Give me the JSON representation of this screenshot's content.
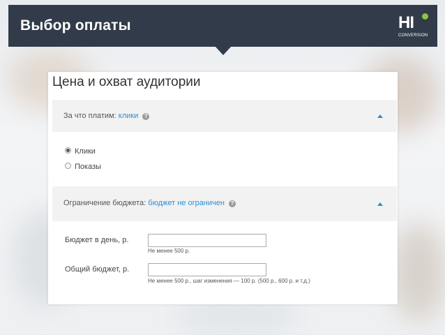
{
  "header": {
    "title": "Выбор оплаты",
    "logo_main": "HI",
    "logo_sub": "CONVERSION"
  },
  "panel": {
    "title": "Цена и охват аудитории",
    "payment_section": {
      "label": "За что платим:",
      "value": "клики",
      "help_icon": "question-icon",
      "options": [
        {
          "label": "Клики",
          "checked": true
        },
        {
          "label": "Показы",
          "checked": false
        }
      ]
    },
    "budget_section": {
      "label": "Ограничение бюджета:",
      "value": "бюджет не ограничен",
      "help_icon": "question-icon",
      "fields": [
        {
          "label": "Бюджет в день, р.",
          "value": "",
          "hint": "Не менее 500 р."
        },
        {
          "label": "Общий бюджет, р.",
          "value": "",
          "hint": "Не менее 500 р., шаг изменения — 100 р. (500 р., 600 р. и т.д.)"
        }
      ]
    }
  },
  "colors": {
    "header_bg": "#323b4a",
    "accent": "#2a8fd6",
    "logo_dot": "#8cc63f"
  }
}
